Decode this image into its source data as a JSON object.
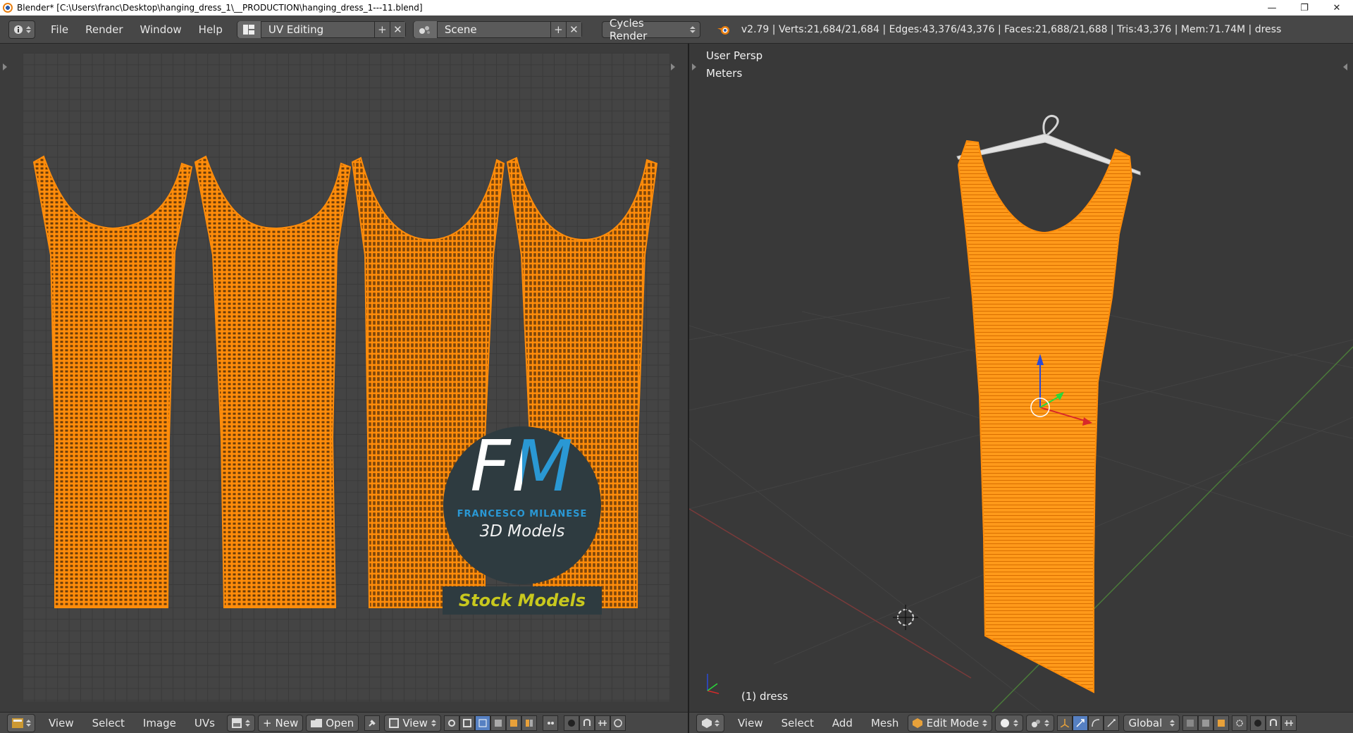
{
  "window": {
    "title": "Blender* [C:\\Users\\franc\\Desktop\\hanging_dress_1\\__PRODUCTION\\hanging_dress_1---11.blend]",
    "minimize": "—",
    "restore": "❐",
    "close": "✕"
  },
  "info_header": {
    "menus": [
      "File",
      "Render",
      "Window",
      "Help"
    ],
    "screen_layout": "UV Editing",
    "scene": "Scene",
    "render_engine": "Cycles Render",
    "stats": "v2.79 | Verts:21,684/21,684 | Edges:43,376/43,376 | Faces:21,688/21,688 | Tris:43,376 | Mem:71.74M | dress"
  },
  "uv_editor": {
    "menus": [
      "View",
      "Select",
      "Image",
      "UVs"
    ],
    "new_label": "New",
    "open_label": "Open",
    "view_label": "View",
    "watermark": {
      "logo_letters": "FM",
      "brand": "FRANCESCO MILANESE",
      "tagline": "3D Models",
      "banner": "Stock Models"
    }
  },
  "viewport": {
    "view_name": "User Persp",
    "units": "Meters",
    "object_label": "(1) dress",
    "menus": [
      "View",
      "Select",
      "Add",
      "Mesh"
    ],
    "mode": "Edit Mode",
    "orientation": "Global"
  },
  "colors": {
    "mesh": "#ff8c0a",
    "accent_blue": "#2a98d4",
    "banner_text": "#c8c81e"
  }
}
